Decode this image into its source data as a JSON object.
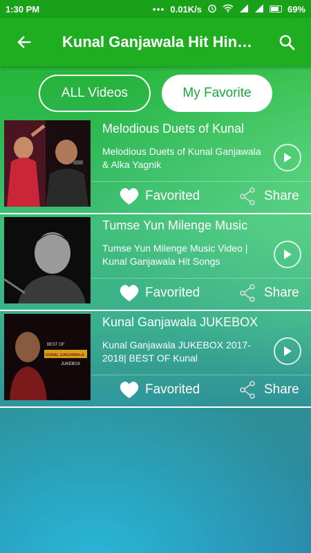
{
  "status_bar": {
    "time": "1:30 PM",
    "dots": "•••",
    "speed": "0.01K/s",
    "battery": "69%"
  },
  "app_bar": {
    "title": "Kunal Ganjawala Hit Hin…",
    "back_icon": "arrow-back-icon",
    "search_icon": "search-icon",
    "color": "#1fae1f"
  },
  "tabs": [
    {
      "label": "ALL Videos",
      "selected": false
    },
    {
      "label": "My Favorite",
      "selected": true
    }
  ],
  "videos": [
    {
      "title": "Melodious Duets of Kunal",
      "description": "Melodious Duets of Kunal Ganjawala & Alka Yagnik",
      "favorite_label": "Favorited",
      "share_label": "Share"
    },
    {
      "title": "Tumse Yun Milenge Music",
      "description": "Tumse Yun Milenge Music Video | Kunal Ganjawala Hit Songs",
      "favorite_label": "Favorited",
      "share_label": "Share"
    },
    {
      "title": "Kunal Ganjawala JUKEBOX",
      "description": "Kunal Ganjawala JUKEBOX 2017-2018| BEST OF Kunal",
      "favorite_label": "Favorited",
      "share_label": "Share",
      "thumb_text": {
        "line1": "BEST OF",
        "line2": "KUNAL GANJAWALA",
        "line3": "JUKEBOX"
      }
    }
  ]
}
